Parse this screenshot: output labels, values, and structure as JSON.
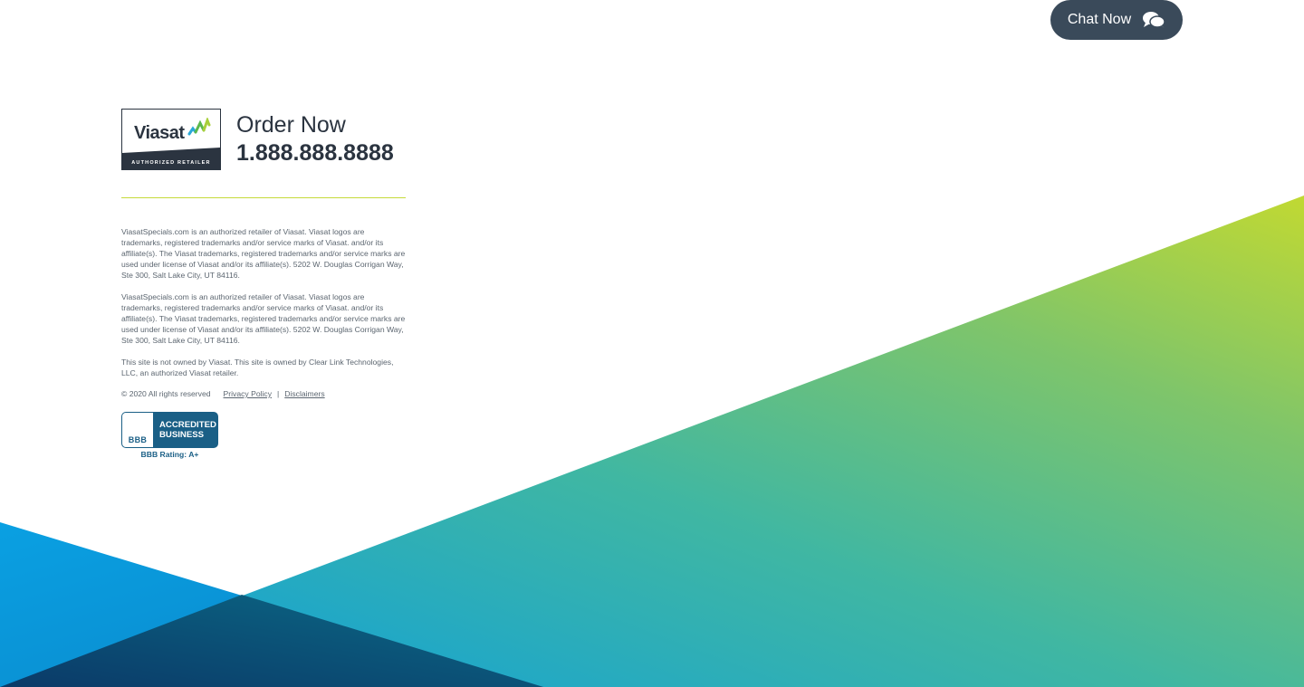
{
  "chat": {
    "label": "Chat Now",
    "icon": "chat-bubbles-icon"
  },
  "brand": {
    "logo_word": "Viasat",
    "logo_badge": "AUTHORIZED RETAILER",
    "order_label": "Order Now",
    "phone": "1.888.888.8888"
  },
  "legal": {
    "para1": "ViasatSpecials.com is an authorized retailer of Viasat. Viasat logos are trademarks, registered trademarks and/or service marks of Viasat. and/or its affiliate(s). The Viasat trademarks, registered trademarks and/or service marks are used under license of Viasat and/or its affiliate(s). 5202 W. Douglas Corrigan Way, Ste 300, Salt Lake City, UT 84116.",
    "para2": "ViasatSpecials.com is an authorized retailer of Viasat. Viasat logos are trademarks, registered trademarks and/or service marks of Viasat. and/or its affiliate(s). The Viasat trademarks, registered trademarks and/or service marks are used under license of Viasat and/or its affiliate(s). 5202 W. Douglas Corrigan Way, Ste 300, Salt Lake City, UT 84116.",
    "para3": "This site is not owned by Viasat. This site is owned by Clear Link Technologies, LLC, an authorized Viasat retailer.",
    "copyright": "© 2020 All rights reserved",
    "privacy_link": "Privacy Policy",
    "separator": "|",
    "disclaimers_link": "Disclaimers"
  },
  "bbb": {
    "logo_text": "BBB",
    "line1": "ACCREDITED",
    "line2": "BUSINESS",
    "rating": "BBB Rating: A+"
  },
  "colors": {
    "accent_green": "#c5da3b",
    "teal": "#3aa9a8",
    "blue": "#0a9de0",
    "navy": "#0e3b66",
    "dark_text": "#2b3440",
    "chat_bg": "#3a4a5a",
    "bbb_blue": "#1a5f86"
  }
}
